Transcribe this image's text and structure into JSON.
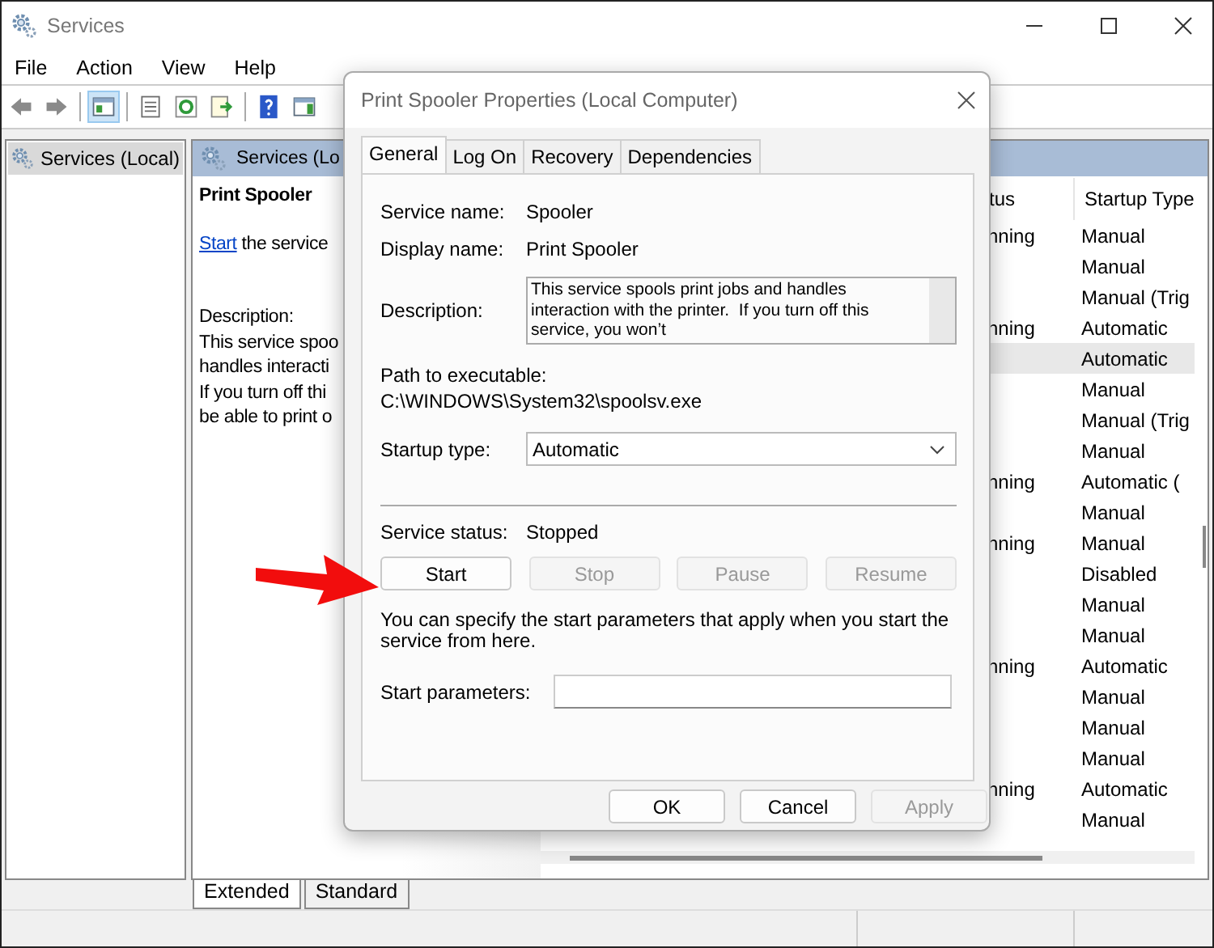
{
  "window": {
    "title": "Services"
  },
  "menu": [
    "File",
    "Action",
    "View",
    "Help"
  ],
  "toolbar": [
    [
      {
        "kind": "back",
        "selected": false
      },
      {
        "kind": "forward",
        "selected": false
      }
    ],
    [
      {
        "kind": "tree-toggle",
        "selected": true
      }
    ],
    [
      {
        "kind": "properties",
        "selected": false
      },
      {
        "kind": "refresh",
        "selected": false
      },
      {
        "kind": "export",
        "selected": false
      }
    ],
    [
      {
        "kind": "help",
        "selected": false
      },
      {
        "kind": "action-pane",
        "selected": false
      }
    ]
  ],
  "tree": {
    "items": [
      {
        "label": "Services (Local)",
        "selected": true
      }
    ]
  },
  "pane": {
    "header": "Services (Lo",
    "service_name": "Print Spooler",
    "action_link": "Start",
    "action_text": " the service",
    "description_label": "Description:",
    "description_lines": [
      "This service spoo",
      "handles interacti",
      "If you turn off thi",
      "be able to print o"
    ]
  },
  "list": {
    "columns": [
      "tus",
      "Startup Type"
    ],
    "rows": [
      {
        "status": "nning",
        "startup": "Manual",
        "selected": false
      },
      {
        "status": "",
        "startup": "Manual",
        "selected": false
      },
      {
        "status": "",
        "startup": "Manual (Trig",
        "selected": false
      },
      {
        "status": "nning",
        "startup": "Automatic",
        "selected": false
      },
      {
        "status": "",
        "startup": "Automatic",
        "selected": true
      },
      {
        "status": "",
        "startup": "Manual",
        "selected": false
      },
      {
        "status": "",
        "startup": "Manual (Trig",
        "selected": false
      },
      {
        "status": "",
        "startup": "Manual",
        "selected": false
      },
      {
        "status": "nning",
        "startup": "Automatic (",
        "selected": false
      },
      {
        "status": "",
        "startup": "Manual",
        "selected": false
      },
      {
        "status": "nning",
        "startup": "Manual",
        "selected": false
      },
      {
        "status": "",
        "startup": "Disabled",
        "selected": false
      },
      {
        "status": "",
        "startup": "Manual",
        "selected": false
      },
      {
        "status": "",
        "startup": "Manual",
        "selected": false
      },
      {
        "status": "nning",
        "startup": "Automatic",
        "selected": false
      },
      {
        "status": "",
        "startup": "Manual",
        "selected": false
      },
      {
        "status": "",
        "startup": "Manual",
        "selected": false
      },
      {
        "status": "",
        "startup": "Manual",
        "selected": false
      },
      {
        "status": "nning",
        "startup": "Automatic",
        "selected": false
      },
      {
        "status": "",
        "startup": "Manual",
        "selected": false
      }
    ]
  },
  "view_tabs": [
    {
      "label": "Extended",
      "selected": true
    },
    {
      "label": "Standard",
      "selected": false
    }
  ],
  "dialog": {
    "title": "Print Spooler Properties (Local Computer)",
    "tabs": [
      {
        "label": "General",
        "selected": true
      },
      {
        "label": "Log On",
        "selected": false
      },
      {
        "label": "Recovery",
        "selected": false
      },
      {
        "label": "Dependencies",
        "selected": false
      }
    ],
    "fields": [
      {
        "label": "Service name:",
        "value": "Spooler"
      },
      {
        "label": "Display name:",
        "value": "Print Spooler"
      }
    ],
    "description": {
      "label": "Description:",
      "value": "This service spools print jobs and handles interaction with the printer.  If you turn off this service, you won’t"
    },
    "path": {
      "label": "Path to executable:",
      "value": "C:\\WINDOWS\\System32\\spoolsv.exe"
    },
    "startup": {
      "label": "Startup type:",
      "value": "Automatic"
    },
    "status": {
      "label": "Service status:",
      "value": "Stopped"
    },
    "service_buttons": [
      {
        "label": "Start",
        "disabled": false
      },
      {
        "label": "Stop",
        "disabled": true
      },
      {
        "label": "Pause",
        "disabled": true
      },
      {
        "label": "Resume",
        "disabled": true
      }
    ],
    "hint": "You can specify the start parameters that apply when you start the service from here.",
    "params": {
      "label": "Start parameters:"
    },
    "buttons": [
      {
        "label": "OK",
        "disabled": false
      },
      {
        "label": "Cancel",
        "disabled": false
      },
      {
        "label": "Apply",
        "disabled": true
      }
    ]
  }
}
